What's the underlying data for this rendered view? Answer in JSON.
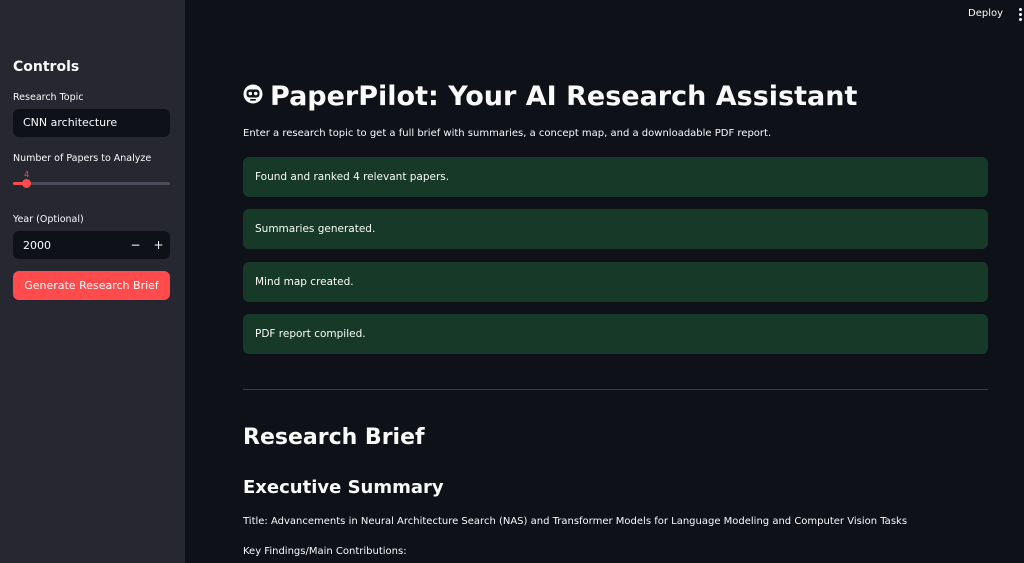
{
  "header": {
    "deploy_label": "Deploy",
    "menu_icon": "kebab-menu-icon"
  },
  "sidebar": {
    "title": "Controls",
    "research_topic": {
      "label": "Research Topic",
      "value": "CNN architecture"
    },
    "papers_slider": {
      "label": "Number of Papers to Analyze",
      "value": "4",
      "fraction": 0.08
    },
    "year": {
      "label": "Year (Optional)",
      "value": "2000",
      "minus_label": "−",
      "plus_label": "+"
    },
    "generate_button": "Generate Research Brief"
  },
  "main": {
    "title_icon": "robot-face-icon",
    "title": "PaperPilot: Your AI Research Assistant",
    "intro": "Enter a research topic to get a full brief with summaries, a concept map, and a downloadable PDF report.",
    "alerts": [
      "Found and ranked 4 relevant papers.",
      "Summaries generated.",
      "Mind map created.",
      "PDF report compiled."
    ],
    "brief_heading": "Research Brief",
    "summary_heading": "Executive Summary",
    "summary_title_line": "Title: Advancements in Neural Architecture Search (NAS) and Transformer Models for Language Modeling and Computer Vision Tasks",
    "key_findings_label": "Key Findings/Main Contributions:"
  },
  "colors": {
    "accent": "#ff4b4b",
    "success_bg": "#173928",
    "sidebar_bg": "#262730",
    "main_bg": "#0e1117"
  }
}
